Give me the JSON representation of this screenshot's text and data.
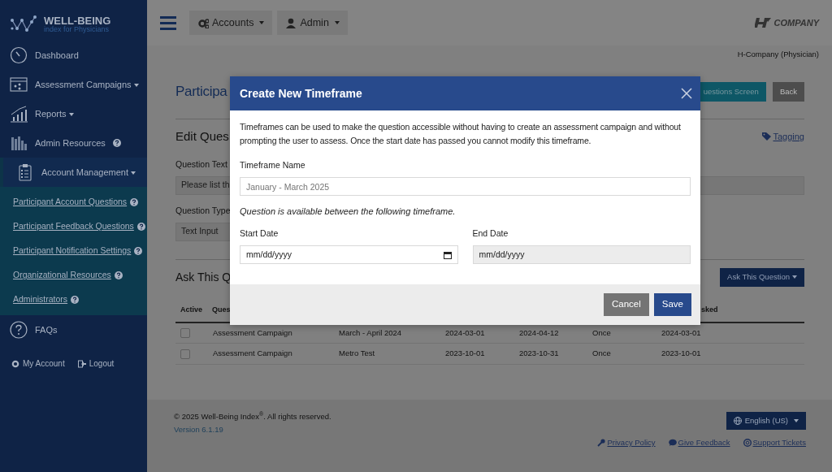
{
  "sidebar": {
    "logo": {
      "title": "WELL-BEING",
      "subtitle": "index for Physicians"
    },
    "items": [
      {
        "label": "Dashboard",
        "dropdown": false,
        "help": false,
        "expanded": false
      },
      {
        "label": "Assessment Campaigns",
        "dropdown": true,
        "help": false,
        "expanded": false
      },
      {
        "label": "Reports",
        "dropdown": true,
        "help": false,
        "expanded": false
      },
      {
        "label": "Admin Resources",
        "dropdown": false,
        "help": true,
        "expanded": false
      },
      {
        "label": "Account Management",
        "dropdown": true,
        "help": false,
        "expanded": true,
        "children": [
          {
            "label": "Participant Account Questions",
            "help": true
          },
          {
            "label": "Participant Feedback Questions",
            "help": true
          },
          {
            "label": "Participant Notification Settings",
            "help": true
          },
          {
            "label": "Organizational Resources",
            "help": true
          },
          {
            "label": "Administrators",
            "help": true
          }
        ]
      },
      {
        "label": "FAQs",
        "dropdown": false,
        "help": false,
        "expanded": false
      }
    ],
    "footer_links": [
      "My Account",
      "Logout"
    ]
  },
  "topbar": {
    "menus": [
      "Accounts",
      "Admin"
    ],
    "brand": "COMPANY",
    "user": "H-Company (Physician)"
  },
  "page": {
    "title": "Participa",
    "buttons": [
      "uestions Screen",
      "Back"
    ],
    "section": "Edit Ques",
    "tagging": "Tagging",
    "fields": [
      {
        "label": "Question Text",
        "value": "Please list th"
      },
      {
        "label": "Question Type",
        "value": "Text Input"
      }
    ],
    "ask": {
      "title": "Ask This Q",
      "button": "Ask This Question"
    },
    "table": {
      "columns": {
        "column_1": "Active",
        "column_2": "Ques",
        "column_7": "sked"
      },
      "rows": [
        {
          "checked": false,
          "cells": [
            "Assessment Campaign",
            "March - April 2024",
            "2024-03-01",
            "2024-04-12",
            "Once",
            "2024-03-01"
          ]
        },
        {
          "checked": false,
          "cells": [
            "Assessment Campaign",
            "Metro Test",
            "2023-10-01",
            "2023-10-31",
            "Once",
            "2023-10-01"
          ]
        }
      ]
    }
  },
  "modal": {
    "title": "Create New Timeframe",
    "intro": "Timeframes can be used to make the question accessible without having to create an assessment campaign and without prompting the user to assess. Once the start date has passed you cannot modify this timeframe.",
    "name_label": "Timeframe Name",
    "name_placeholder": "January - March 2025",
    "note": "Question is available between the following timeframe.",
    "dates": [
      {
        "label": "Start Date",
        "value": "mm/dd/yyyy",
        "disabled": false
      },
      {
        "label": "End Date",
        "value": "mm/dd/yyyy",
        "disabled": true
      }
    ],
    "buttons": [
      "Cancel",
      "Save"
    ]
  },
  "footer": {
    "copyright": "© 2025 Well-Being Index$^{®}$. All rights reserved.",
    "version": "Version 6.1.19",
    "language": "English (US)",
    "links": [
      "Privacy Policy",
      "Give Feedback",
      "Support Tickets"
    ]
  }
}
